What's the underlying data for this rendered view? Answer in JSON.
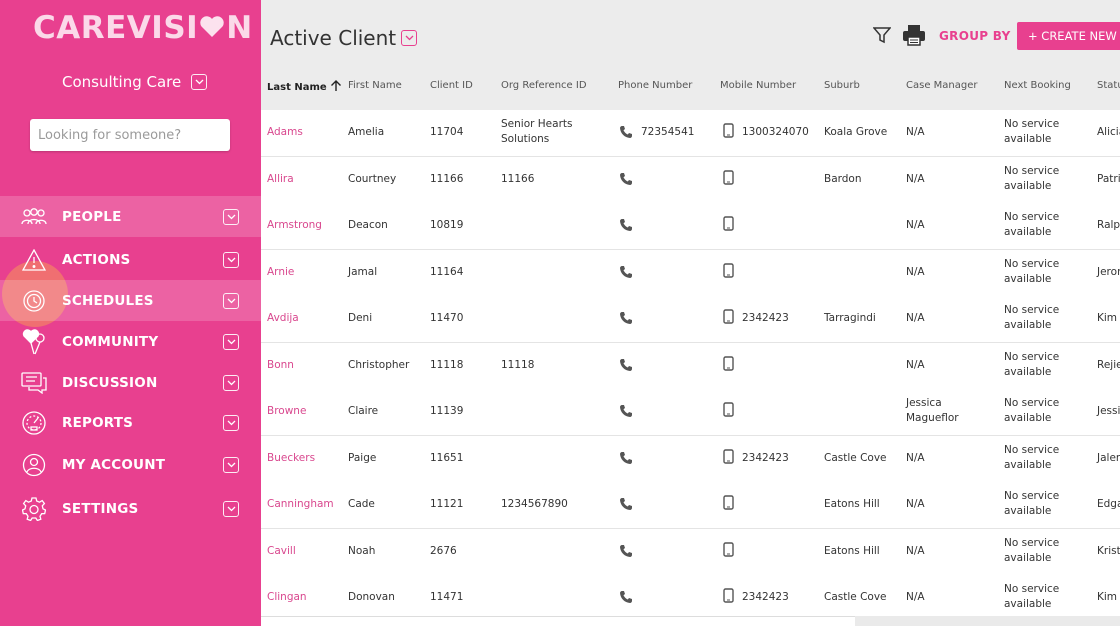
{
  "app": {
    "logo_text": "CAREVISI",
    "logo_end": "N"
  },
  "sidebar": {
    "org_name": "Consulting Care",
    "search_placeholder": "Looking for someone?",
    "items": [
      {
        "label": "PEOPLE",
        "icon": "people-icon"
      },
      {
        "label": "ACTIONS",
        "icon": "warning-icon"
      },
      {
        "label": "SCHEDULES",
        "icon": "clock-icon"
      },
      {
        "label": "COMMUNITY",
        "icon": "balloon-heart-icon"
      },
      {
        "label": "DISCUSSION",
        "icon": "chat-icon"
      },
      {
        "label": "REPORTS",
        "icon": "gauge-icon"
      },
      {
        "label": "MY ACCOUNT",
        "icon": "user-icon"
      },
      {
        "label": "SETTINGS",
        "icon": "gear-icon"
      }
    ]
  },
  "header": {
    "title": "Active Client",
    "group_by": "GROUP BY",
    "create_button": "+ CREATE NEW CL"
  },
  "table": {
    "columns": [
      "Last Name",
      "First Name",
      "Client ID",
      "Org Reference ID",
      "Phone Number",
      "Mobile Number",
      "Suburb",
      "Case Manager",
      "Next Booking",
      "Status"
    ],
    "rows": [
      {
        "last": "Adams",
        "first": "Amelia",
        "id": "11704",
        "org1": "Senior Hearts",
        "org2": "Solutions",
        "phone": "72354541",
        "mobile": "1300324070",
        "suburb": "Koala Grove",
        "cm1": "N/A",
        "cm2": "",
        "nb1": "No service",
        "nb2": "available",
        "status": "Alicia"
      },
      {
        "last": "Allira",
        "first": "Courtney",
        "id": "11166",
        "org1": "11166",
        "org2": "",
        "phone": "",
        "mobile": "",
        "suburb": "Bardon",
        "cm1": "N/A",
        "cm2": "",
        "nb1": "No service",
        "nb2": "available",
        "status": "Patri"
      },
      {
        "last": "Armstrong",
        "first": "Deacon",
        "id": "10819",
        "org1": "",
        "org2": "",
        "phone": "",
        "mobile": "",
        "suburb": "",
        "cm1": "N/A",
        "cm2": "",
        "nb1": "No service",
        "nb2": "available",
        "status": "Ralp"
      },
      {
        "last": "Arnie",
        "first": "Jamal",
        "id": "11164",
        "org1": "",
        "org2": "",
        "phone": "",
        "mobile": "",
        "suburb": "",
        "cm1": "N/A",
        "cm2": "",
        "nb1": "No service",
        "nb2": "available",
        "status": "Jeron"
      },
      {
        "last": "Avdija",
        "first": "Deni",
        "id": "11470",
        "org1": "",
        "org2": "",
        "phone": "",
        "mobile": "2342423",
        "suburb": "Tarragindi",
        "cm1": "N/A",
        "cm2": "",
        "nb1": "No service",
        "nb2": "available",
        "status": "Kim"
      },
      {
        "last": "Bonn",
        "first": "Christopher",
        "id": "11118",
        "org1": "11118",
        "org2": "",
        "phone": "",
        "mobile": "",
        "suburb": "",
        "cm1": "N/A",
        "cm2": "",
        "nb1": "No service",
        "nb2": "available",
        "status": "Rejie"
      },
      {
        "last": "Browne",
        "first": "Claire",
        "id": "11139",
        "org1": "",
        "org2": "",
        "phone": "",
        "mobile": "",
        "suburb": "",
        "cm1": "Jessica",
        "cm2": "Magueflor",
        "nb1": "No service",
        "nb2": "available",
        "status": "Jessi"
      },
      {
        "last": "Bueckers",
        "first": "Paige",
        "id": "11651",
        "org1": "",
        "org2": "",
        "phone": "",
        "mobile": "2342423",
        "suburb": "Castle Cove",
        "cm1": "N/A",
        "cm2": "",
        "nb1": "No service",
        "nb2": "available",
        "status": "Jalen"
      },
      {
        "last": "Canningham",
        "first": "Cade",
        "id": "11121",
        "org1": "1234567890",
        "org2": "",
        "phone": "",
        "mobile": "",
        "suburb": "Eatons Hill",
        "cm1": "N/A",
        "cm2": "",
        "nb1": "No service",
        "nb2": "available",
        "status": "Edga"
      },
      {
        "last": "Cavill",
        "first": "Noah",
        "id": "2676",
        "org1": "",
        "org2": "",
        "phone": "",
        "mobile": "",
        "suburb": "Eatons Hill",
        "cm1": "N/A",
        "cm2": "",
        "nb1": "No service",
        "nb2": "available",
        "status": "Krist"
      },
      {
        "last": "Clingan",
        "first": "Donovan",
        "id": "11471",
        "org1": "",
        "org2": "",
        "phone": "",
        "mobile": "2342423",
        "suburb": "Castle Cove",
        "cm1": "N/A",
        "cm2": "",
        "nb1": "No service",
        "nb2": "available",
        "status": "Kim"
      }
    ]
  },
  "colors": {
    "brand": "#e8408f",
    "click_highlight": "#f6965a"
  }
}
